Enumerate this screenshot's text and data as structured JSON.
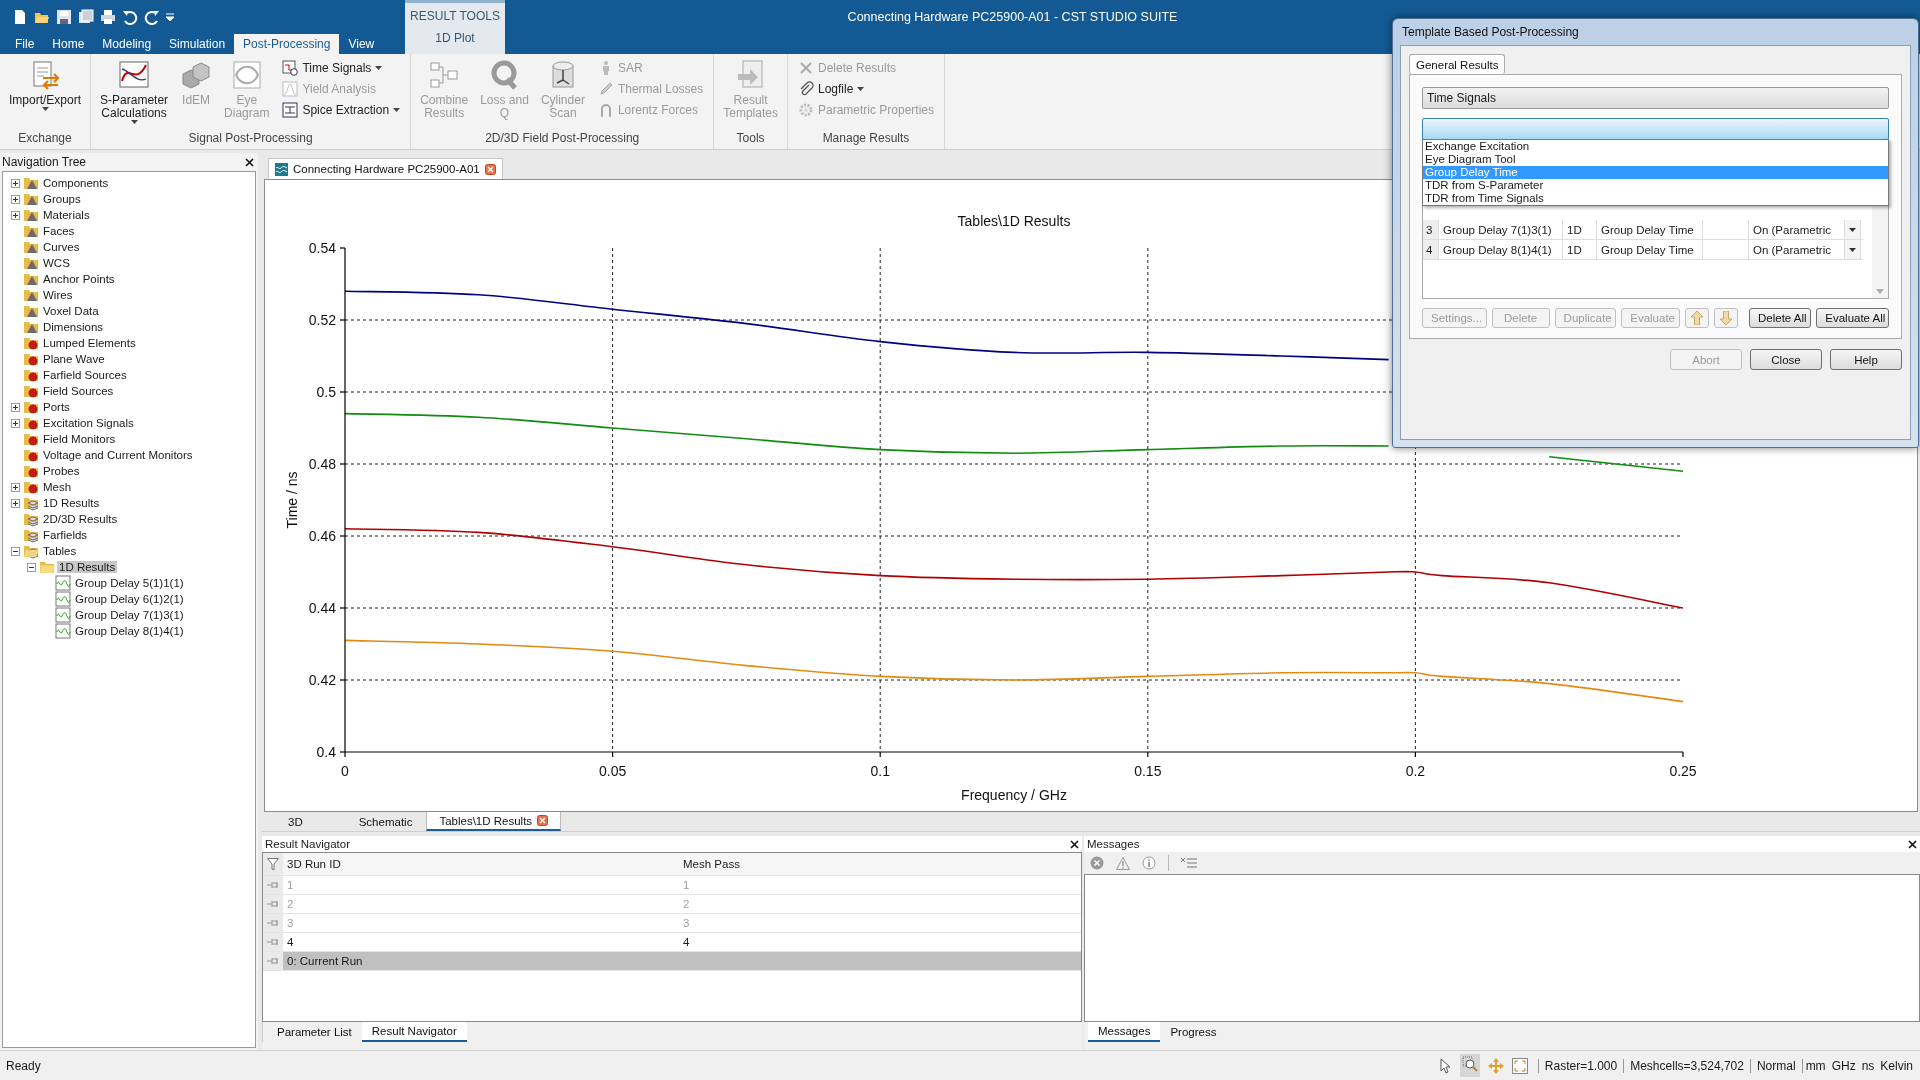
{
  "window": {
    "title": "Connecting Hardware PC25900-A01 - CST STUDIO SUITE"
  },
  "menu_tabs": [
    {
      "label": "File",
      "selected": false
    },
    {
      "label": "Home",
      "selected": false
    },
    {
      "label": "Modeling",
      "selected": false
    },
    {
      "label": "Simulation",
      "selected": false
    },
    {
      "label": "Post-Processing",
      "selected": true
    },
    {
      "label": "View",
      "selected": false
    }
  ],
  "context_tab": {
    "group": "RESULT TOOLS",
    "tabs": [
      {
        "label": "1D Plot",
        "selected": false
      }
    ]
  },
  "ribbon": {
    "groups": [
      {
        "label": "Exchange",
        "items": [
          {
            "kind": "large",
            "label": "Import/Export",
            "dropdown": true,
            "disabled": false
          }
        ]
      },
      {
        "label": "Signal Post-Processing",
        "items": [
          {
            "kind": "large",
            "label": "S-Parameter\nCalculations",
            "dropdown": true,
            "disabled": false
          },
          {
            "kind": "large",
            "label": "IdEM",
            "dropdown": false,
            "disabled": true
          },
          {
            "kind": "large",
            "label": "Eye\nDiagram",
            "dropdown": false,
            "disabled": true
          },
          {
            "kind": "stack",
            "items": [
              {
                "label": "Time Signals",
                "dropdown": true,
                "disabled": false
              },
              {
                "label": "Yield Analysis",
                "dropdown": false,
                "disabled": true
              },
              {
                "label": "Spice Extraction",
                "dropdown": true,
                "disabled": false
              }
            ]
          }
        ]
      },
      {
        "label": "2D/3D Field Post-Processing",
        "items": [
          {
            "kind": "large",
            "label": "Combine\nResults",
            "dropdown": false,
            "disabled": true
          },
          {
            "kind": "large",
            "label": "Loss and\nQ",
            "dropdown": false,
            "disabled": true
          },
          {
            "kind": "large",
            "label": "Cylinder\nScan",
            "dropdown": false,
            "disabled": true
          },
          {
            "kind": "stack",
            "items": [
              {
                "label": "SAR",
                "dropdown": false,
                "disabled": true
              },
              {
                "label": "Thermal Losses",
                "dropdown": false,
                "disabled": true
              },
              {
                "label": "Lorentz Forces",
                "dropdown": false,
                "disabled": true
              }
            ]
          }
        ]
      },
      {
        "label": "Tools",
        "items": [
          {
            "kind": "large",
            "label": "Result\nTemplates",
            "dropdown": false,
            "disabled": true
          }
        ]
      },
      {
        "label": "Manage Results",
        "items": [
          {
            "kind": "stack",
            "items": [
              {
                "label": "Delete Results",
                "dropdown": false,
                "disabled": true
              },
              {
                "label": "Logfile",
                "dropdown": true,
                "disabled": false
              },
              {
                "label": "Parametric Properties",
                "dropdown": false,
                "disabled": true
              }
            ]
          }
        ]
      }
    ]
  },
  "navigation_tree": {
    "title": "Navigation Tree",
    "items": [
      {
        "label": "Components",
        "kind": "model",
        "expanded": false,
        "selected": false
      },
      {
        "label": "Groups",
        "kind": "model",
        "expanded": false,
        "selected": false
      },
      {
        "label": "Materials",
        "kind": "model",
        "expanded": false,
        "selected": false
      },
      {
        "label": "Faces",
        "kind": "model",
        "selected": false
      },
      {
        "label": "Curves",
        "kind": "model",
        "selected": false
      },
      {
        "label": "WCS",
        "kind": "model",
        "selected": false
      },
      {
        "label": "Anchor Points",
        "kind": "model",
        "selected": false
      },
      {
        "label": "Wires",
        "kind": "model",
        "selected": false
      },
      {
        "label": "Voxel Data",
        "kind": "model",
        "selected": false
      },
      {
        "label": "Dimensions",
        "kind": "model",
        "selected": false
      },
      {
        "label": "Lumped Elements",
        "kind": "source",
        "selected": false
      },
      {
        "label": "Plane Wave",
        "kind": "source",
        "selected": false
      },
      {
        "label": "Farfield Sources",
        "kind": "source",
        "selected": false
      },
      {
        "label": "Field Sources",
        "kind": "source",
        "selected": false
      },
      {
        "label": "Ports",
        "kind": "source",
        "expanded": false,
        "selected": false
      },
      {
        "label": "Excitation Signals",
        "kind": "source",
        "expanded": false,
        "selected": false
      },
      {
        "label": "Field Monitors",
        "kind": "source",
        "selected": false
      },
      {
        "label": "Voltage and Current Monitors",
        "kind": "source",
        "selected": false
      },
      {
        "label": "Probes",
        "kind": "source",
        "selected": false
      },
      {
        "label": "Mesh",
        "kind": "source",
        "expanded": false,
        "selected": false
      },
      {
        "label": "1D Results",
        "kind": "result",
        "expanded": false,
        "selected": false
      },
      {
        "label": "2D/3D Results",
        "kind": "result",
        "selected": false
      },
      {
        "label": "Farfields",
        "kind": "result",
        "selected": false
      },
      {
        "label": "Tables",
        "kind": "result",
        "expanded": true,
        "selected": false,
        "children": [
          {
            "label": "1D Results",
            "kind": "folder",
            "expanded": true,
            "selected": true,
            "children": [
              {
                "label": "Group Delay 5(1)1(1)",
                "kind": "curve",
                "selected": false
              },
              {
                "label": "Group Delay 6(1)2(1)",
                "kind": "curve",
                "selected": false
              },
              {
                "label": "Group Delay 7(1)3(1)",
                "kind": "curve",
                "selected": false
              },
              {
                "label": "Group Delay 8(1)4(1)",
                "kind": "curve",
                "selected": false
              }
            ]
          }
        ]
      }
    ]
  },
  "document": {
    "tabs": [
      {
        "label": "Connecting Hardware PC25900-A01",
        "selected": true,
        "closable": true
      }
    ],
    "chart_data": {
      "type": "line",
      "title": "Tables\\1D Results",
      "xlabel": "Frequency / GHz",
      "ylabel": "Time / ns",
      "x": [
        0,
        0.025,
        0.05,
        0.075,
        0.1,
        0.125,
        0.15,
        0.175,
        0.195,
        0.2,
        0.205,
        0.225,
        0.25
      ],
      "series": [
        {
          "color": "#000080",
          "values": [
            0.528,
            0.527,
            0.523,
            0.519,
            0.514,
            0.511,
            0.511,
            0.51,
            0.509,
            null,
            null,
            null,
            null
          ]
        },
        {
          "color": "#108c10",
          "values": [
            0.494,
            0.493,
            0.49,
            0.487,
            0.484,
            0.483,
            0.484,
            0.485,
            0.485,
            null,
            null,
            0.482,
            0.478
          ]
        },
        {
          "color": "#b00000",
          "values": [
            0.462,
            0.461,
            0.457,
            0.452,
            0.449,
            0.448,
            0.448,
            0.449,
            0.45,
            0.45,
            0.449,
            0.447,
            0.44
          ]
        },
        {
          "color": "#e08c10",
          "values": [
            0.431,
            0.43,
            0.428,
            0.424,
            0.421,
            0.42,
            0.421,
            0.422,
            0.422,
            0.422,
            0.421,
            0.419,
            0.414
          ]
        }
      ],
      "grid": true,
      "xlim": [
        0,
        0.25
      ],
      "ylim": [
        0.4,
        0.54
      ],
      "xticks": [
        0,
        0.05,
        0.1,
        0.15,
        0.2,
        0.25
      ],
      "yticks": [
        0.4,
        0.42,
        0.44,
        0.46,
        0.48,
        0.5,
        0.52,
        0.54
      ]
    },
    "view_tabs": [
      {
        "label": "3D",
        "selected": false,
        "closable": false
      },
      {
        "label": "Schematic",
        "selected": false,
        "closable": false
      },
      {
        "label": "Tables\\1D Results",
        "selected": true,
        "closable": true
      }
    ]
  },
  "result_navigator": {
    "title": "Result Navigator",
    "columns": [
      "3D Run ID",
      "Mesh Pass"
    ],
    "rows": [
      {
        "cells": [
          "1",
          "1"
        ],
        "disabled": true,
        "selected": false
      },
      {
        "cells": [
          "2",
          "2"
        ],
        "disabled": true,
        "selected": false
      },
      {
        "cells": [
          "3",
          "3"
        ],
        "disabled": true,
        "selected": false
      },
      {
        "cells": [
          "4",
          "4"
        ],
        "disabled": false,
        "selected": false
      },
      {
        "cells": [
          "0: Current Run"
        ],
        "disabled": false,
        "selected": true
      }
    ],
    "tabs": [
      {
        "label": "Parameter List",
        "selected": false
      },
      {
        "label": "Result Navigator",
        "selected": true
      }
    ]
  },
  "messages": {
    "title": "Messages",
    "tabs": [
      {
        "label": "Messages",
        "selected": true
      },
      {
        "label": "Progress",
        "selected": false
      }
    ]
  },
  "status_bar": {
    "text": "Ready",
    "fields": [
      "Raster=1.000",
      "Meshcells=3,524,702",
      "Normal",
      "mm",
      "GHz",
      "ns",
      "Kelvin"
    ]
  },
  "dialog": {
    "title": "Template Based Post-Processing",
    "tabs": [
      {
        "label": "General Results",
        "selected": true
      }
    ],
    "category": "Time Signals",
    "template_options": [
      {
        "label": "Exchange Excitation",
        "selected": false
      },
      {
        "label": "Eye Diagram Tool",
        "selected": false
      },
      {
        "label": "Group Delay Time",
        "selected": true
      },
      {
        "label": "TDR from S-Parameter",
        "selected": false
      },
      {
        "label": "TDR from Time Signals",
        "selected": false
      }
    ],
    "rows": [
      {
        "number": "3",
        "name": "Group Delay 7(1)3(1)",
        "type": "1D",
        "template": "Group Delay Time",
        "status": "On (Parametric"
      },
      {
        "number": "4",
        "name": "Group Delay 8(1)4(1)",
        "type": "1D",
        "template": "Group Delay Time",
        "status": "On (Parametric"
      }
    ],
    "buttons": [
      {
        "kind": "text",
        "label": "Settings...",
        "disabled": true
      },
      {
        "kind": "text",
        "label": "Delete",
        "disabled": true
      },
      {
        "kind": "text",
        "label": "Duplicate",
        "disabled": true
      },
      {
        "kind": "text",
        "label": "Evaluate",
        "disabled": true
      },
      {
        "kind": "up",
        "disabled": true
      },
      {
        "kind": "down",
        "disabled": true
      },
      {
        "kind": "text",
        "label": "Delete All",
        "disabled": false
      },
      {
        "kind": "text",
        "label": "Evaluate All",
        "disabled": false
      }
    ],
    "footer_buttons": [
      {
        "label": "Abort",
        "disabled": true
      },
      {
        "label": "Close",
        "disabled": false
      },
      {
        "label": "Help",
        "disabled": false
      }
    ]
  }
}
